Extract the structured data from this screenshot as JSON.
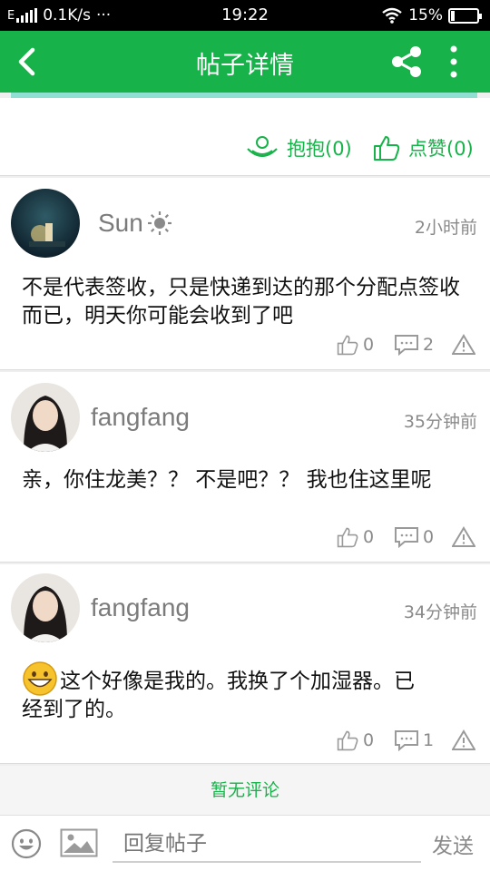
{
  "status_bar": {
    "network_type": "E",
    "speed": "0.1K/s",
    "dots": "···",
    "time": "19:22",
    "battery": "15%",
    "battery_level": 0.15
  },
  "header": {
    "title": "帖子详情",
    "accent_color": "#17b249"
  },
  "post_actions": {
    "hug_label": "抱抱(0)",
    "like_label": "点赞(0)"
  },
  "comments": [
    {
      "user": "Sun",
      "user_icon": "sun-icon",
      "time": "2小时前",
      "text": "不是代表签收，只是快递到达的那个分配点签收而已，明天你可能会收到了吧",
      "likes": "0",
      "replies": "2"
    },
    {
      "user": "fangfang",
      "time": "35分钟前",
      "text": "亲，你住龙美？？ 不是吧？？ 我也住这里呢",
      "likes": "0",
      "replies": "0"
    },
    {
      "user": "fangfang",
      "time": "34分钟前",
      "emoji": "grinning-emoji",
      "text": "这个好像是我的。我换了个加湿器。已经到了的。",
      "likes": "0",
      "replies": "1"
    }
  ],
  "no_more_comments": "暂无评论",
  "bottom_bar": {
    "reply_placeholder": "回复帖子",
    "send_label": "发送"
  }
}
